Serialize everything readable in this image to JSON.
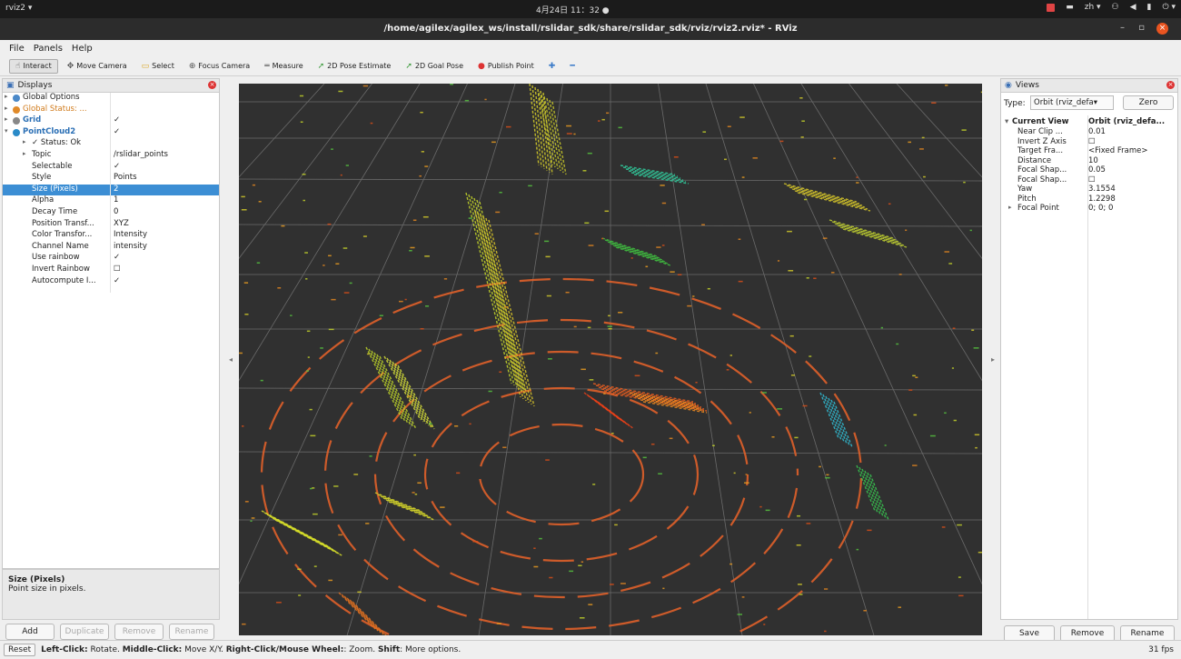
{
  "topbar": {
    "app": "rviz2 ▾",
    "clock": "4月24日 11：32 ●",
    "lang": "zh ▾",
    "power": "⏻ ▾"
  },
  "window": {
    "title": "/home/agilex/agilex_ws/install/rslidar_sdk/share/rslidar_sdk/rviz/rviz2.rviz* - RViz",
    "min": "–",
    "max": "▫",
    "close": "×"
  },
  "menu": [
    "File",
    "Panels",
    "Help"
  ],
  "toolbar": [
    {
      "label": "Interact",
      "icon": "hand-icon",
      "glyph": "☝",
      "active": true
    },
    {
      "label": "Move Camera",
      "icon": "move-camera-icon",
      "glyph": "✥"
    },
    {
      "label": "Select",
      "icon": "select-icon",
      "glyph": "▭"
    },
    {
      "label": "Focus Camera",
      "icon": "focus-icon",
      "glyph": "⊕"
    },
    {
      "label": "Measure",
      "icon": "measure-icon",
      "glyph": "═"
    },
    {
      "label": "2D Pose Estimate",
      "icon": "pose-estimate-icon",
      "glyph": "➚"
    },
    {
      "label": "2D Goal Pose",
      "icon": "goal-pose-icon",
      "glyph": "➚"
    },
    {
      "label": "Publish Point",
      "icon": "publish-point-icon",
      "glyph": "●"
    }
  ],
  "displays": {
    "title": "Displays",
    "rows": [
      {
        "name": "Global Options",
        "value": "",
        "kind": "tree",
        "dot": "#4a88c8"
      },
      {
        "name": "Global Status: ...",
        "value": "",
        "kind": "tree",
        "dot": "#e08a2a",
        "color": "#d07a1a"
      },
      {
        "name": "Grid",
        "value": "✓",
        "kind": "tree",
        "dot": "#888",
        "color": "#2a6fb5",
        "bold": true
      },
      {
        "name": "PointCloud2",
        "value": "✓",
        "kind": "tree-open",
        "dot": "#2a8ac8",
        "color": "#2a6fb5",
        "bold": true
      },
      {
        "name": "✓ Status: Ok",
        "value": "",
        "kind": "child-tree"
      },
      {
        "name": "Topic",
        "value": "/rslidar_points",
        "kind": "child-tree"
      },
      {
        "name": "Selectable",
        "value": "✓",
        "kind": "child"
      },
      {
        "name": "Style",
        "value": "Points",
        "kind": "child"
      },
      {
        "name": "Size (Pixels)",
        "value": "2",
        "kind": "child",
        "selected": true
      },
      {
        "name": "Alpha",
        "value": "1",
        "kind": "child"
      },
      {
        "name": "Decay Time",
        "value": "0",
        "kind": "child"
      },
      {
        "name": "Position Transf...",
        "value": "XYZ",
        "kind": "child"
      },
      {
        "name": "Color Transfor...",
        "value": "Intensity",
        "kind": "child"
      },
      {
        "name": "Channel Name",
        "value": "intensity",
        "kind": "child"
      },
      {
        "name": "Use rainbow",
        "value": "✓",
        "kind": "child"
      },
      {
        "name": "Invert Rainbow",
        "value": "☐",
        "kind": "child"
      },
      {
        "name": "Autocompute I...",
        "value": "✓",
        "kind": "child"
      }
    ],
    "help_title": "Size (Pixels)",
    "help_text": "Point size in pixels.",
    "buttons": [
      "Add",
      "Duplicate",
      "Remove",
      "Rename"
    ]
  },
  "views": {
    "title": "Views",
    "type_label": "Type:",
    "type_value": "Orbit (rviz_defa▾",
    "zero": "Zero",
    "current_name": "Current View",
    "current_value": "Orbit (rviz_defa...",
    "rows": [
      {
        "name": "Near Clip ...",
        "value": "0.01"
      },
      {
        "name": "Invert Z Axis",
        "value": "☐"
      },
      {
        "name": "Target Fra...",
        "value": "<Fixed Frame>"
      },
      {
        "name": "Distance",
        "value": "10"
      },
      {
        "name": "Focal Shap...",
        "value": "0.05"
      },
      {
        "name": "Focal Shap...",
        "value": "☐"
      },
      {
        "name": "Yaw",
        "value": "3.1554"
      },
      {
        "name": "Pitch",
        "value": "1.2298"
      },
      {
        "name": "Focal Point",
        "value": "0; 0; 0",
        "tree": true
      }
    ],
    "buttons": [
      "Save",
      "Remove",
      "Rename"
    ]
  },
  "status": {
    "reset": "Reset",
    "hint_b1": "Left-Click:",
    "hint_t1": " Rotate. ",
    "hint_b2": "Middle-Click:",
    "hint_t2": " Move X/Y. ",
    "hint_b3": "Right-Click/Mouse Wheel:",
    "hint_t3": ": Zoom. ",
    "hint_b4": "Shift",
    "hint_t4": ": More options.",
    "fps": "31 fps"
  }
}
